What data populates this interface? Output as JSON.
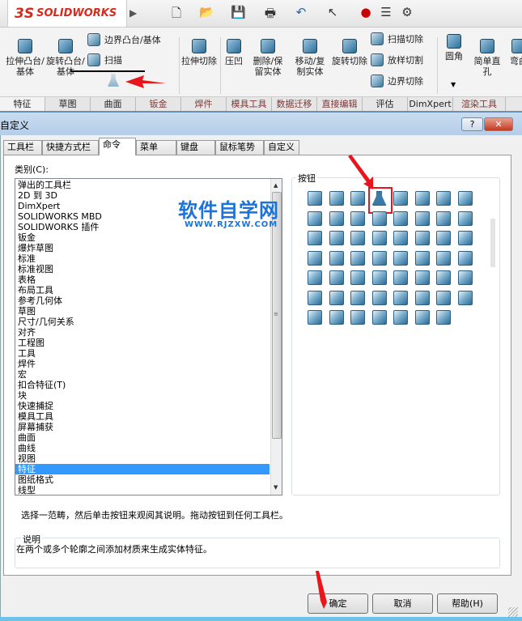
{
  "app": {
    "logo_ds": "3S",
    "logo_text": "SOLIDWORKS"
  },
  "quick_access": [
    {
      "icon": "new-document-icon",
      "glyph": "🗋"
    },
    {
      "icon": "open-folder-icon",
      "glyph": "📂"
    },
    {
      "icon": "save-icon",
      "glyph": "💾"
    },
    {
      "icon": "print-icon",
      "glyph": "🖶"
    },
    {
      "icon": "undo-icon",
      "glyph": "↶"
    },
    {
      "icon": "select-cursor-icon",
      "glyph": "↖"
    },
    {
      "icon": "rebuild-traffic-light-icon",
      "glyph": "●"
    },
    {
      "icon": "file-properties-icon",
      "glyph": "☰"
    },
    {
      "icon": "options-gear-icon",
      "glyph": "⚙"
    }
  ],
  "ribbon": {
    "extrude_boss": "拉伸凸台/基体",
    "revolve_boss": "旋转凸台/基体",
    "boundary_boss": "边界凸台/基体",
    "sweep": "扫描",
    "extrude_cut": "拉伸切除",
    "indent": "压凹",
    "delete_keep_body": "删除/保留实体",
    "move_copy_body": "移动/复制实体",
    "revolve_cut": "旋转切除",
    "swept_cut": "扫描切除",
    "lofted_cut": "放样切割",
    "boundary_cut": "边界切除",
    "fillet": "圆角",
    "simple_hole": "简单直孔",
    "flex": "弯曲"
  },
  "ribbon_tabs": [
    "特征",
    "草图",
    "曲面",
    "钣金",
    "焊件",
    "模具工具",
    "数据迁移",
    "直接编辑",
    "评估",
    "DimXpert",
    "渲染工具"
  ],
  "dialog": {
    "title": "自定义",
    "help_btn": "?",
    "close_btn": "✕",
    "tabs": [
      "工具栏",
      "快捷方式栏",
      "命令",
      "菜单",
      "键盘",
      "鼠标笔势",
      "自定义"
    ],
    "active_tab": "命令",
    "category_label": "类别(C):",
    "categories": [
      "弹出的工具栏",
      "2D 到 3D",
      "DimXpert",
      "SOLIDWORKS MBD",
      "SOLIDWORKS 插件",
      "钣金",
      "爆炸草图",
      "标准",
      "标准视图",
      "表格",
      "布局工具",
      "参考几何体",
      "草图",
      "尺寸/几何关系",
      "对齐",
      "工程图",
      "工具",
      "焊件",
      "宏",
      "扣合特征(T)",
      "块",
      "快速捕捉",
      "模具工具",
      "屏幕捕获",
      "曲面",
      "曲线",
      "视图",
      "特征",
      "图纸格式",
      "线型"
    ],
    "selected_category": "特征",
    "buttons_label": "按钮",
    "button_icons": [
      "extrude-boss-icon",
      "revolve-boss-icon",
      "sweep-icon",
      "loft-icon",
      "boundary-boss-icon",
      "extrude-cut-icon",
      "hole-wizard-icon",
      "revolve-cut-icon",
      "swept-cut-icon",
      "lofted-cut-icon",
      "boundary-cut-icon",
      "split-icon",
      "fillet-icon",
      "chamfer-icon",
      "rib-icon",
      "draft-icon",
      "shell-icon",
      "wrap-icon",
      "simple-hole-icon",
      "hole-series-icon",
      "thread-icon",
      "cosmetic-thread-icon",
      "dome-icon",
      "shape-icon",
      "deform-icon",
      "indent-icon",
      "flex-icon",
      "intersect-icon",
      "freeform-icon",
      "split-line-icon",
      "move-face-icon",
      "move-copy-body-icon",
      "move-icon",
      "rotate-icon",
      "linear-pattern-icon",
      "circular-pattern-icon",
      "mirror-icon",
      "table-pattern-icon",
      "sketch-pattern-icon",
      "curve-pattern-icon",
      "fill-pattern-icon",
      "variable-pattern-icon",
      "combine-icon",
      "join-icon",
      "thicken-icon",
      "cavity-icon",
      "delete-body-icon",
      "scale-icon",
      "save-bodies-icon",
      "create-assembly-icon",
      "imported-geometry-icon",
      "feature-works-icon",
      "instant3d-icon",
      "verification-icon",
      "3d-grid-icon"
    ],
    "hint": "选择一范畴，然后单击按钮来观阅其说明。拖动按钮到任何工具栏。",
    "desc_label": "说明",
    "desc_text": "在两个或多个轮廓之间添加材质来生成实体特征。",
    "ok": "确定",
    "cancel": "取消",
    "help": "帮助(H)"
  },
  "watermark": {
    "cn": "软件自学网",
    "url": "WWW.RJZXW.COM"
  },
  "colors": {
    "accent": "#3399ff",
    "brand_red": "#d52b1e",
    "annotation_red": "#e8161c"
  }
}
